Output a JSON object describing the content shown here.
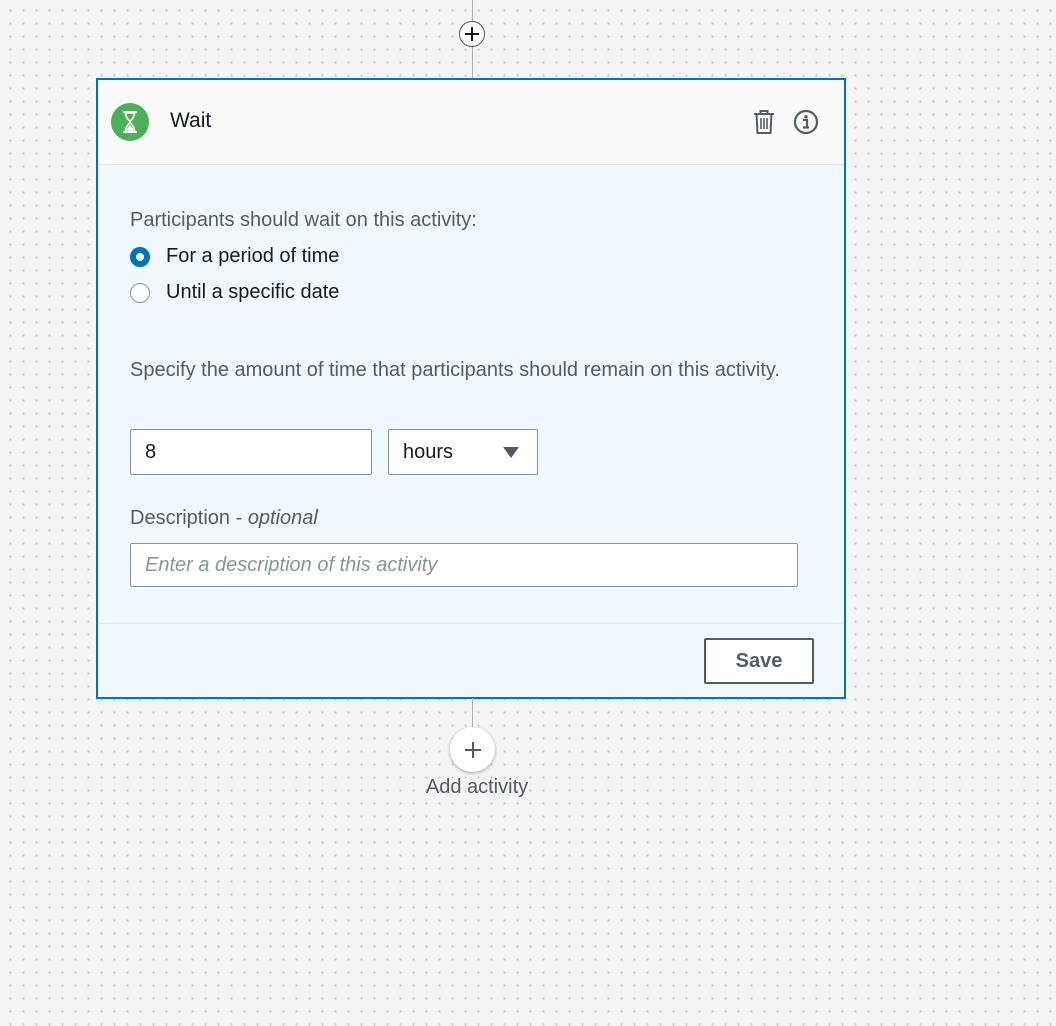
{
  "card": {
    "title": "Wait",
    "badge_icon": "hourglass-icon",
    "badge_color": "#4cb05a",
    "accent_color": "#0073bb",
    "delete_icon": "trash-icon",
    "info_icon": "info-icon"
  },
  "wait_mode": {
    "question": "Participants should wait on this activity:",
    "options": [
      {
        "label": "For a period of time",
        "selected": true
      },
      {
        "label": "Until a specific date",
        "selected": false
      }
    ]
  },
  "duration": {
    "instruction": "Specify the amount of time that participants should remain on this activity.",
    "amount": "8",
    "unit": "hours"
  },
  "description": {
    "label": "Description - ",
    "optional": "optional",
    "placeholder": "Enter a description of this activity",
    "value": ""
  },
  "footer": {
    "save_label": "Save"
  },
  "flow": {
    "add_activity_label": "Add activity",
    "add_icon": "plus-icon"
  }
}
